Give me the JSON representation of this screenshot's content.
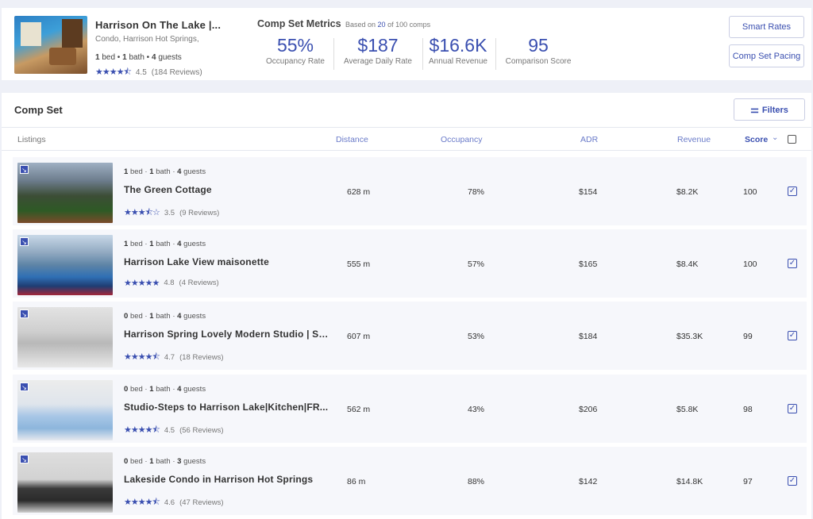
{
  "property": {
    "title": "Harrison On The Lake |...",
    "subtitle": "Condo, Harrison Hot Springs,",
    "beds": "1",
    "bed_label": "bed",
    "baths": "1",
    "bath_label": "bath",
    "guests": "4",
    "guest_label": "guests",
    "rating": "4.5",
    "reviews": "(184 Reviews)"
  },
  "metrics": {
    "title": "Comp Set Metrics",
    "based_prefix": "Based on",
    "based_count": "20",
    "based_suffix": "of 100 comps",
    "items": [
      {
        "value": "55%",
        "label": "Occupancy Rate"
      },
      {
        "value": "$187",
        "label": "Average Daily Rate"
      },
      {
        "value": "$16.6K",
        "label": "Annual Revenue"
      },
      {
        "value": "95",
        "label": "Comparison Score"
      }
    ]
  },
  "buttons": {
    "smart_rates": "Smart Rates",
    "comp_set_pacing": "Comp Set Pacing",
    "filters": "Filters"
  },
  "comp_set": {
    "title": "Comp Set",
    "columns": {
      "listings": "Listings",
      "distance": "Distance",
      "occupancy": "Occupancy",
      "adr": "ADR",
      "revenue": "Revenue",
      "score": "Score"
    },
    "rows": [
      {
        "beds": "1",
        "baths": "1",
        "guests": "4",
        "name": "The Green Cottage",
        "stars": "★★★⯪☆",
        "rating": "3.5",
        "reviews": "(9 Reviews)",
        "distance": "628 m",
        "occupancy": "78%",
        "adr": "$154",
        "revenue": "$8.2K",
        "score": "100"
      },
      {
        "beds": "1",
        "baths": "1",
        "guests": "4",
        "name": "Harrison Lake View maisonette",
        "stars": "★★★★★",
        "rating": "4.8",
        "reviews": "(4 Reviews)",
        "distance": "555 m",
        "occupancy": "57%",
        "adr": "$165",
        "revenue": "$8.4K",
        "score": "100"
      },
      {
        "beds": "0",
        "baths": "1",
        "guests": "4",
        "name": "Harrison Spring Lovely Modern Studio | Sui...",
        "stars": "★★★★⯪",
        "rating": "4.7",
        "reviews": "(18 Reviews)",
        "distance": "607 m",
        "occupancy": "53%",
        "adr": "$184",
        "revenue": "$35.3K",
        "score": "99"
      },
      {
        "beds": "0",
        "baths": "1",
        "guests": "4",
        "name": "Studio-Steps to Harrison Lake|Kitchen|FR...",
        "stars": "★★★★⯪",
        "rating": "4.5",
        "reviews": "(56 Reviews)",
        "distance": "562 m",
        "occupancy": "43%",
        "adr": "$206",
        "revenue": "$5.8K",
        "score": "98"
      },
      {
        "beds": "0",
        "baths": "1",
        "guests": "3",
        "name": "Lakeside Condo in Harrison Hot Springs",
        "stars": "★★★★⯪",
        "rating": "4.6",
        "reviews": "(47 Reviews)",
        "distance": "86 m",
        "occupancy": "88%",
        "adr": "$142",
        "revenue": "$14.8K",
        "score": "97"
      }
    ]
  },
  "colors": {
    "accent": "#3a4fb0",
    "background": "#eef0f7"
  }
}
